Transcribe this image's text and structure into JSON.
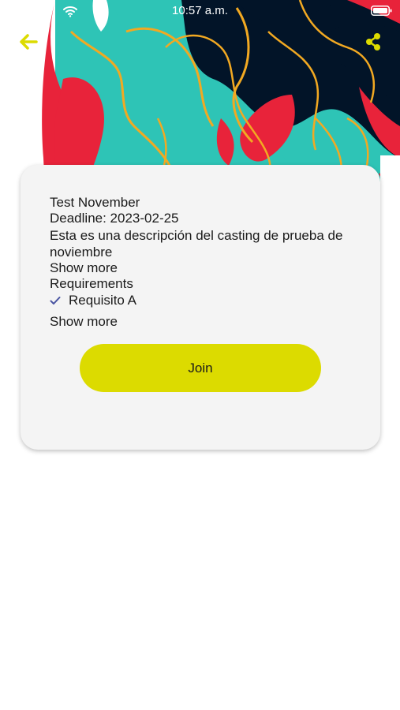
{
  "status_bar": {
    "time": "10:57 a.m.",
    "wifi_icon": "wifi-icon",
    "battery_icon": "battery-icon"
  },
  "header": {
    "back_icon": "arrow-left-icon",
    "share_icon": "share-icon",
    "accent_color": "#dcdb00"
  },
  "hero": {
    "colors": [
      "#2ec4b6",
      "#021428",
      "#e8233a",
      "#f2a922",
      "#ffffff"
    ]
  },
  "casting": {
    "title": "Test November",
    "deadline": "Deadline: 2023-02-25",
    "description": "Esta es una descripción del casting de prueba de noviembre",
    "show_more_description": "Show more",
    "requirements_heading": "Requirements",
    "requirements": [
      {
        "label": "Requisito A",
        "icon": "check-icon"
      }
    ],
    "show_more_requirements": "Show more",
    "join_label": "Join"
  }
}
